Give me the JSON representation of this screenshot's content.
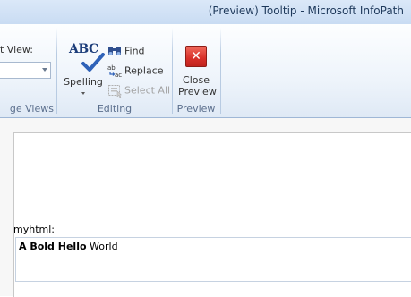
{
  "window": {
    "title": "(Preview) Tooltip  -  Microsoft InfoPath"
  },
  "ribbon": {
    "page_views": {
      "label_top": "t View:",
      "group_label": "ge Views",
      "dropdown_value": ""
    },
    "editing": {
      "spelling_label": "Spelling",
      "find_label": "Find",
      "replace_label": "Replace",
      "select_all_label": "Select All",
      "group_label": "Editing"
    },
    "preview": {
      "close_label_1": "Close",
      "close_label_2": "Preview",
      "group_label": "Preview"
    }
  },
  "form": {
    "field_label": "myhtml:",
    "field_value": {
      "bold_part": "A Bold Hello",
      "plain_part": " World"
    }
  },
  "colors": {
    "accent_blue": "#1c3d7a",
    "close_red": "#d8302a",
    "ribbon_label": "#5a6e8c"
  },
  "icons": [
    "abc-check-icon",
    "binoculars-icon",
    "replace-icon",
    "select-all-icon",
    "close-x-icon",
    "dropdown-arrow-icon"
  ]
}
